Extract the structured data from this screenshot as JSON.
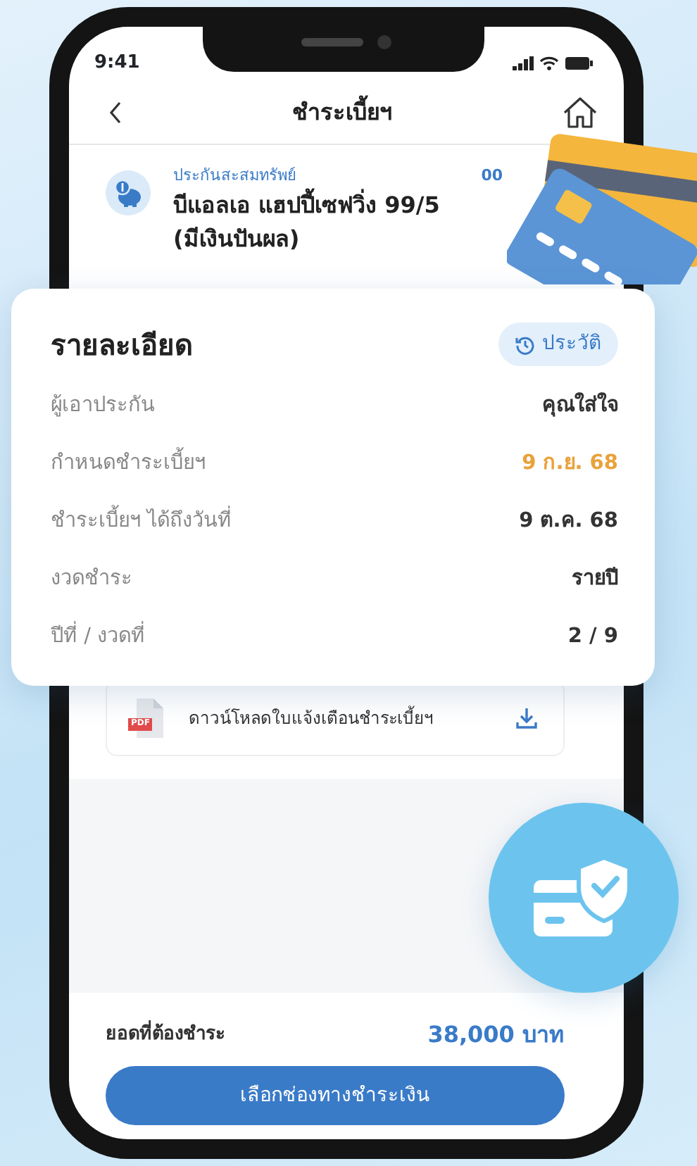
{
  "status_bar": {
    "time": "9:41"
  },
  "header": {
    "title": "ชำระเบี้ยฯ"
  },
  "policy": {
    "category": "ประกันสะสมทรัพย์",
    "name_lines": [
      "บีแอลเอ แฮปปี้เซฟวิ่ง 99/5",
      "(มีเงินปันผล)"
    ],
    "number": "00"
  },
  "details": {
    "title": "รายละเอียด",
    "history_button": "ประวัติ",
    "rows": [
      {
        "label": "ผู้เอาประกัน",
        "value": "คุณใส่ใจ",
        "highlight": false
      },
      {
        "label": "กำหนดชำระเบี้ยฯ",
        "value": "9 ก.ย. 68",
        "highlight": true
      },
      {
        "label": "ชำระเบี้ยฯ ได้ถึงวันที่",
        "value": "9 ต.ค. 68",
        "highlight": false
      },
      {
        "label": "งวดชำระ",
        "value": "รายปี",
        "highlight": false
      },
      {
        "label": "ปีที่ / งวดที่",
        "value": "2 / 9",
        "highlight": false
      }
    ]
  },
  "download": {
    "file_badge": "PDF",
    "label": "ดาวน์โหลดใบแจ้งเตือนชำระเบี้ยฯ"
  },
  "footer": {
    "amount_label": "ยอดที่ต้องชำระ",
    "amount": "38,000 บาท",
    "button": "เลือกช่องทางชำระเงิน"
  }
}
